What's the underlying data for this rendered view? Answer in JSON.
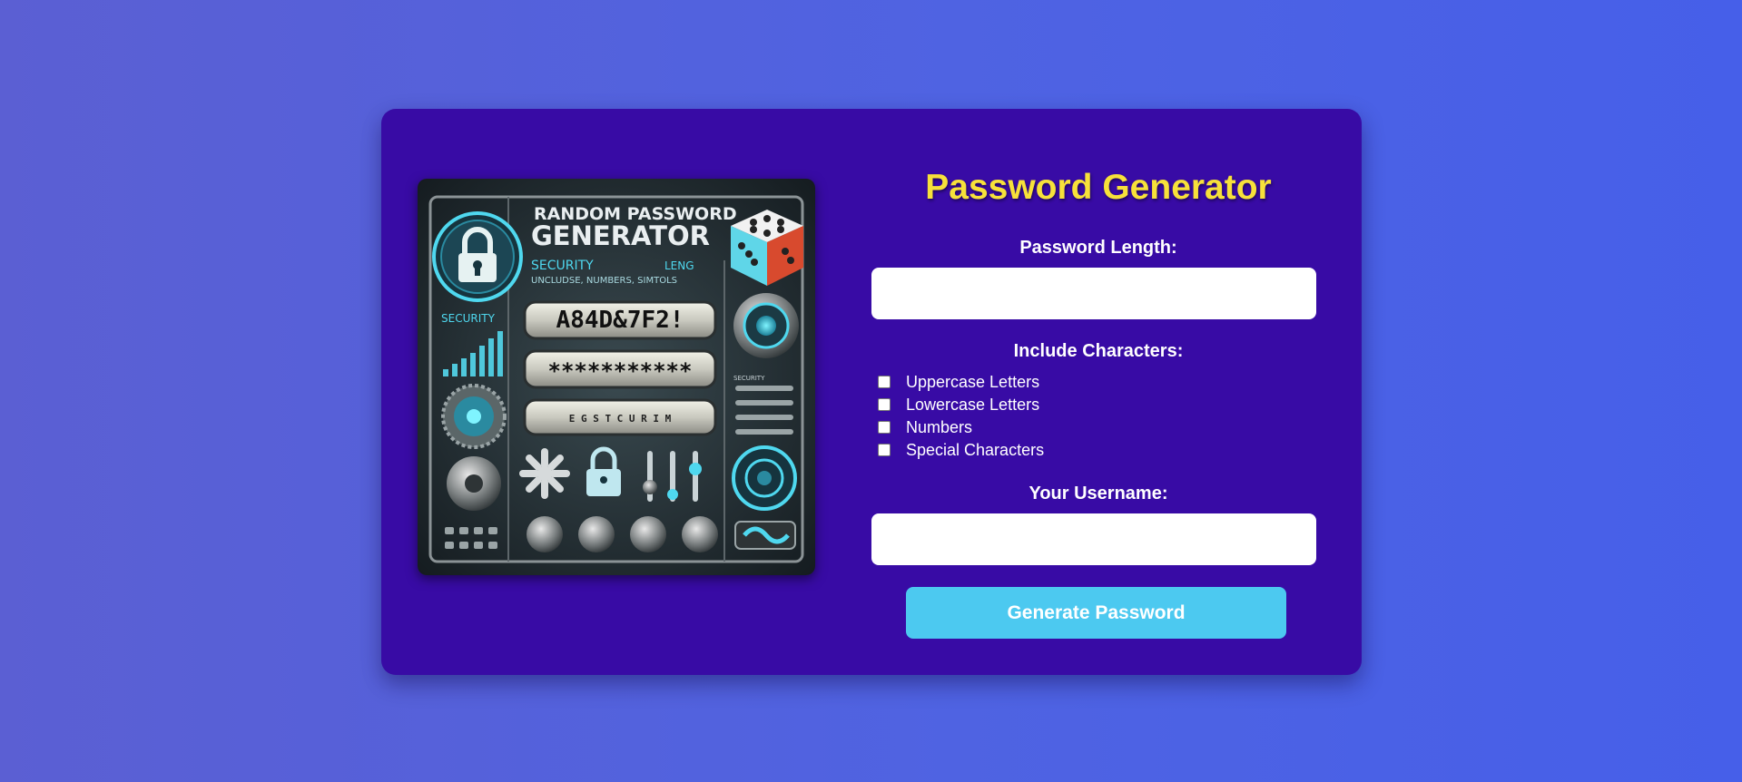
{
  "colors": {
    "background": "#4f63e2",
    "card": "#380ba5",
    "title": "#f7e13a",
    "button": "#4cc9f0"
  },
  "image": {
    "heading_line1": "RANDOM PASSWORD",
    "heading_line2": "GENERATOR",
    "sub_line1": "SECURITY",
    "sub_line1b": "LENG",
    "sub_line2": "UNCLUDSE, NUMBERS, SIMTOLS",
    "security_label": "SECURITY",
    "display_password": "A84D&7F2!",
    "display_masked": "***********",
    "display_bottom": "E G S T C U R I M",
    "side_label": "SECURITY"
  },
  "form": {
    "title": "Password Generator",
    "length_label": "Password Length:",
    "length_value": "",
    "include_label": "Include Characters:",
    "options": [
      {
        "label": "Uppercase Letters",
        "checked": false
      },
      {
        "label": "Lowercase Letters",
        "checked": false
      },
      {
        "label": "Numbers",
        "checked": false
      },
      {
        "label": "Special Characters",
        "checked": false
      }
    ],
    "username_label": "Your Username:",
    "username_value": "",
    "button_label": "Generate Password"
  }
}
